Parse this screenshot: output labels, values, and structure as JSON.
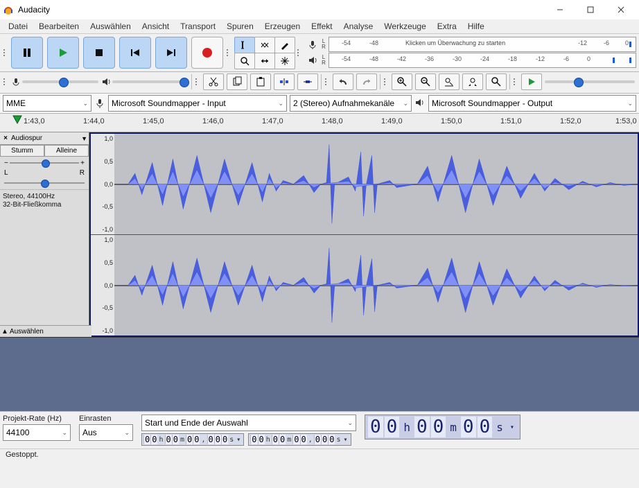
{
  "title": "Audacity",
  "menu": [
    "Datei",
    "Bearbeiten",
    "Auswählen",
    "Ansicht",
    "Transport",
    "Spuren",
    "Erzeugen",
    "Effekt",
    "Analyse",
    "Werkzeuge",
    "Extra",
    "Hilfe"
  ],
  "meter_ticks": [
    "-54",
    "-48",
    "-42",
    "-36",
    "-30",
    "-24",
    "-18",
    "-12",
    "-6",
    "0"
  ],
  "meter_rec_ticks": [
    "-54",
    "-48"
  ],
  "meter_rec_label": "Klicken um Überwachung zu starten",
  "meter_rec_tail": [
    "-12",
    "-6",
    "0"
  ],
  "host_api": "MME",
  "rec_device": "Microsoft Soundmapper - Input",
  "rec_channels": "2 (Stereo) Aufnahmekanäle",
  "play_device": "Microsoft Soundmapper - Output",
  "timeline": [
    "1:43,0",
    "1:44,0",
    "1:45,0",
    "1:46,0",
    "1:47,0",
    "1:48,0",
    "1:49,0",
    "1:50,0",
    "1:51,0",
    "1:52,0",
    "1:53,0"
  ],
  "track": {
    "name": "Audiospur",
    "mute": "Stumm",
    "solo": "Alleine",
    "pan_l": "L",
    "pan_r": "R",
    "info1": "Stereo, 44100Hz",
    "info2": "32-Bit-Fließkomma",
    "select": "Auswählen"
  },
  "scale": [
    "1,0",
    "0,5",
    "0,0",
    "-0,5",
    "-1,0"
  ],
  "bottom": {
    "rate_label": "Projekt-Rate (Hz)",
    "rate_value": "44100",
    "snap_label": "Einrasten",
    "snap_value": "Aus",
    "sel_label": "Start und Ende der Auswahl",
    "time_digits": [
      "0",
      "0",
      "0",
      "0",
      "0",
      "0",
      "0",
      "0",
      "0"
    ],
    "time_units": [
      "h",
      "m",
      "s"
    ],
    "big_digits": [
      "0",
      "0",
      "0",
      "0",
      "0",
      "0"
    ],
    "big_units": [
      "h",
      "m",
      "s"
    ]
  },
  "status": "Gestoppt."
}
